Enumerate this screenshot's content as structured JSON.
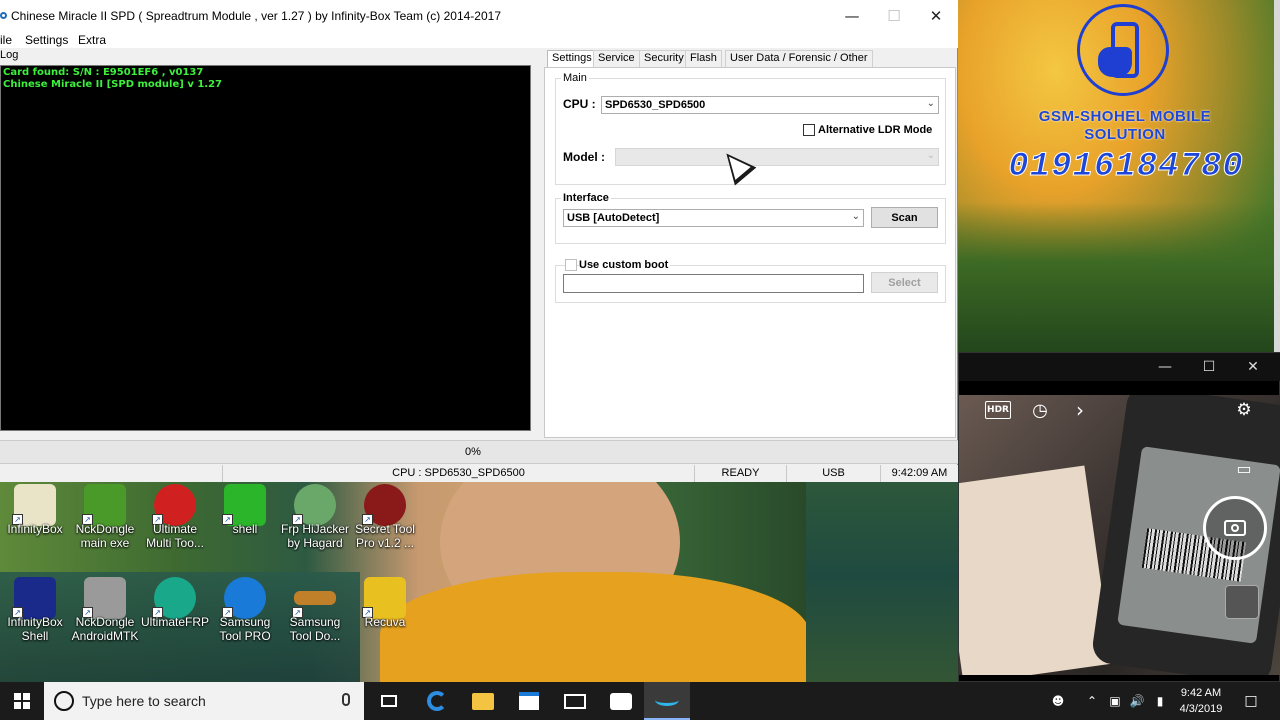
{
  "window": {
    "title": "Chinese Miracle II SPD ( Spreadtrum Module , ver 1.27 ) by Infinity-Box Team (c) 2014-2017",
    "minimize": "—",
    "maximize": "☐",
    "close": "✕"
  },
  "menu": [
    "ile",
    "Settings",
    "Extra"
  ],
  "log": {
    "label": "Log",
    "lines": [
      "Card found: S/N : E9501EF6 , v0137",
      "Chinese Miracle II  [SPD module] v 1.27"
    ]
  },
  "tabs": [
    "Settings",
    "Service",
    "Security",
    "Flash",
    "User Data / Forensic / Other"
  ],
  "main_group": {
    "label": "Main",
    "cpu_label": "CPU :",
    "cpu_value": "SPD6530_SPD6500",
    "alt_ldr_label": "Alternative LDR Mode",
    "alt_ldr_checked": false,
    "model_label": "Model :",
    "model_value": ""
  },
  "interface_group": {
    "label": "Interface",
    "value": "USB [AutoDetect]",
    "scan_button": "Scan"
  },
  "custom_boot": {
    "label": "Use custom boot",
    "checked": false,
    "path": "",
    "select_button": "Select"
  },
  "progress": {
    "text": "0%",
    "value": 0
  },
  "statusbar": {
    "cpu": "CPU : SPD6530_SPD6500",
    "state": "READY",
    "port": "USB",
    "time": "9:42:09 AM"
  },
  "overlay": {
    "brand_name": "GSM-SHOHEL MOBILE SOLUTION",
    "brand_phone": "01916184780"
  },
  "desktop_icons": [
    {
      "label": "InfinityBox",
      "color": "#e8e8e8"
    },
    {
      "label": "NckDongle main exe",
      "color": "#4a9a2a"
    },
    {
      "label": "Ultimate Multi Too...",
      "color": "#d02020"
    },
    {
      "label": "shell",
      "color": "#2ab52a"
    },
    {
      "label": "Frp HiJacker by Hagard",
      "color": "#6aa86a"
    },
    {
      "label": "Secret Tool Pro v1.2 ...",
      "color": "#8a1a1a"
    },
    {
      "label": "InfinityBox Shell",
      "color": "#1a2a8a"
    },
    {
      "label": "NckDongle AndroidMTK",
      "color": "#9a9a9a"
    },
    {
      "label": "UltimateFRP",
      "color": "#1aa88a"
    },
    {
      "label": "Samsung Tool PRO",
      "color": "#1a7ad8"
    },
    {
      "label": "Samsung Tool Do...",
      "color": "#c0802a"
    },
    {
      "label": "Recuva",
      "color": "#e8c020"
    }
  ],
  "camera": {
    "minimize": "—",
    "maximize": "☐",
    "close": "✕",
    "hdr_icon": "HDR",
    "timer_icon": "◷",
    "more_icon": "›",
    "settings_icon": "⚙",
    "video_icon": "▭"
  },
  "taskbar": {
    "search_placeholder": "Type here to search",
    "time": "9:42 AM",
    "date": "4/3/2019"
  }
}
